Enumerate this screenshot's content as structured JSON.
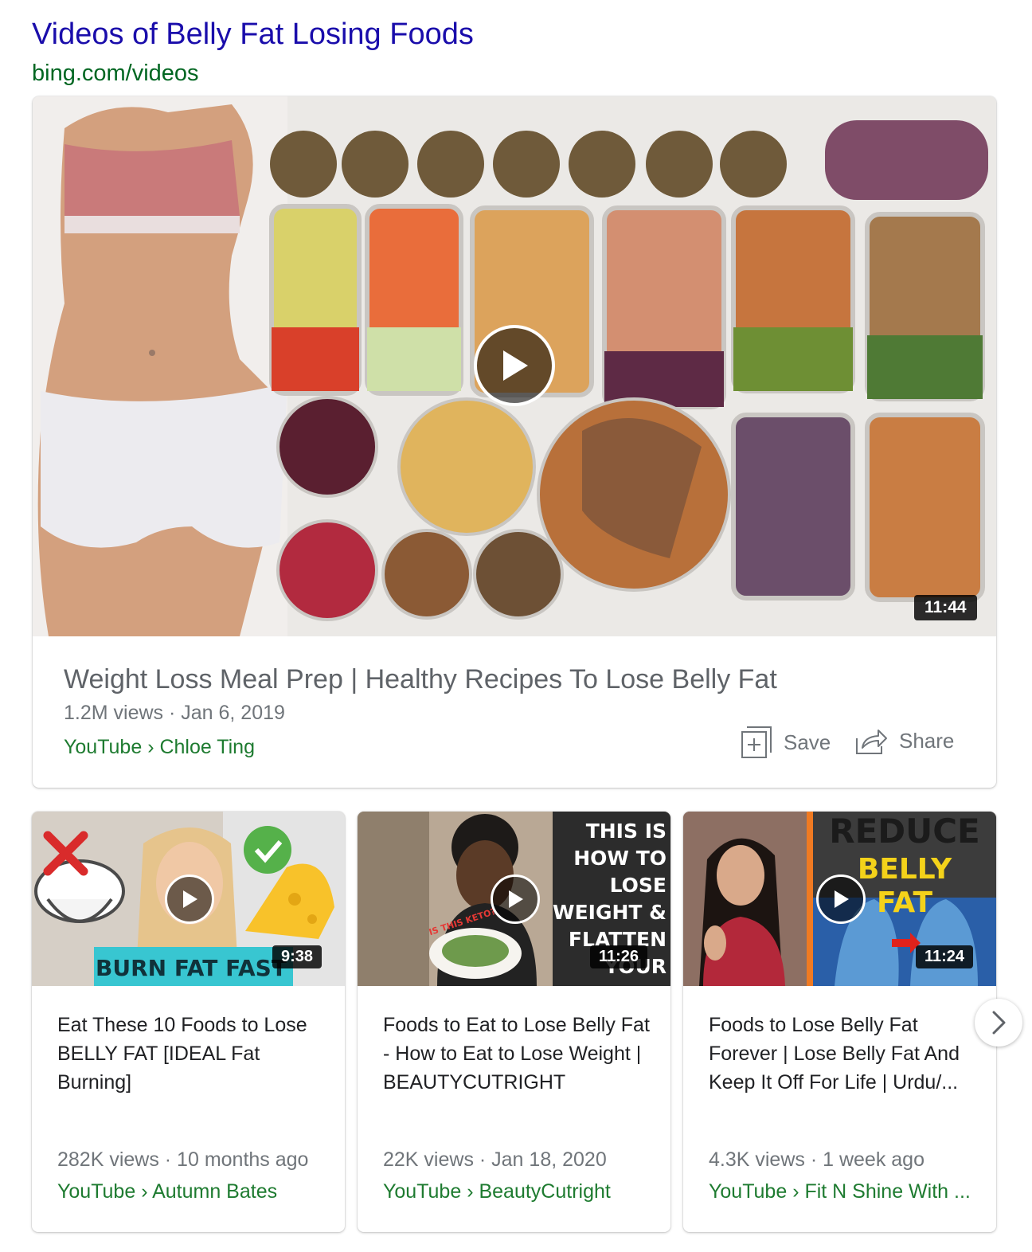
{
  "header": {
    "title": "Videos of Belly Fat Losing Foods",
    "source": "bing.com/videos"
  },
  "featured": {
    "title": "Weight Loss Meal Prep | Healthy Recipes To Lose Belly Fat",
    "meta": "1.2M views · Jan 6, 2019",
    "source": "YouTube › Chloe Ting",
    "duration": "11:44",
    "save_label": "Save",
    "share_label": "Share"
  },
  "videos": [
    {
      "title": "Eat These 10 Foods to Lose BELLY FAT [IDEAL Fat Burning]",
      "meta": "282K views · 10 months ago",
      "source": "YouTube › Autumn Bates",
      "duration": "9:38",
      "thumb_text": "BURN FAT FAST"
    },
    {
      "title": "Foods to Eat to Lose Belly Fat - How to Eat to Lose Weight | BEAUTYCUTRIGHT",
      "meta": "22K views · Jan 18, 2020",
      "source": "YouTube › BeautyCutright",
      "duration": "11:26",
      "thumb_text": "THIS IS HOW TO LOSE WEIGHT & FLATTEN YOUR TUMMY!",
      "thumb_small_text": "IS THIS KETO?"
    },
    {
      "title": "Foods to Lose Belly Fat Forever | Lose Belly Fat And Keep It Off For Life | Urdu/...",
      "meta": "4.3K views · 1 week ago",
      "source": "YouTube › Fit N Shine With ...",
      "duration": "11:24",
      "thumb_text_1": "REDUCE",
      "thumb_text_2": "BELLY FAT"
    }
  ],
  "colors": {
    "link": "#1a0dab",
    "url_green": "#006621",
    "meta_gray": "#70757a",
    "source_green": "#1e7b30"
  }
}
